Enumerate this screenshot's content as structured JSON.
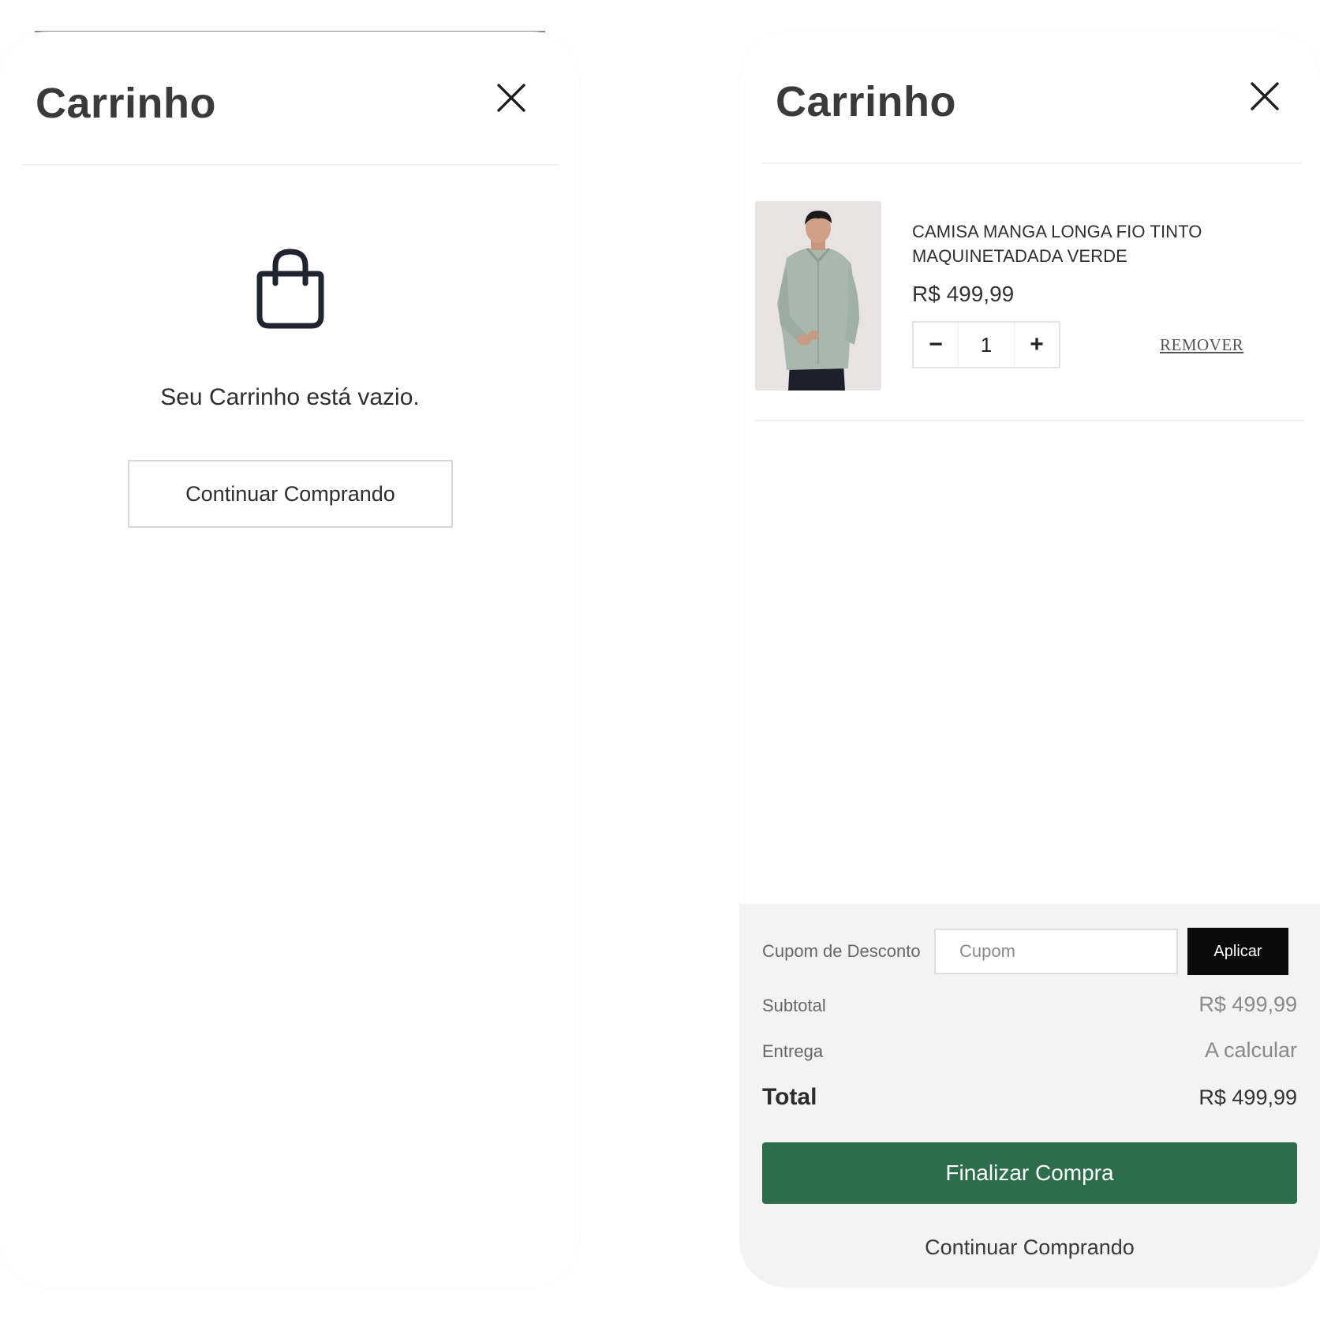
{
  "empty_cart": {
    "title": "Carrinho",
    "close_icon": "close-icon",
    "bag_icon": "shopping-bag-icon",
    "message": "Seu Carrinho está vazio.",
    "continue_label": "Continuar Comprando"
  },
  "filled_cart": {
    "title": "Carrinho",
    "close_icon": "close-icon",
    "item": {
      "name": "CAMISA MANGA LONGA FIO TINTO MAQUINETADADA VERDE",
      "price": "R$ 499,99",
      "quantity": "1",
      "decrease_label": "−",
      "increase_label": "+",
      "remove_label": "REMOVER"
    },
    "summary": {
      "coupon_label": "Cupom de Desconto",
      "coupon_placeholder": "Cupom",
      "coupon_value": "",
      "apply_label": "Aplicar",
      "subtotal_label": "Subtotal",
      "subtotal_value": "R$ 499,99",
      "delivery_label": "Entrega",
      "delivery_value": "A calcular",
      "total_label": "Total",
      "total_value": "R$ 499,99",
      "checkout_label": "Finalizar Compra",
      "continue_label": "Continuar Comprando"
    }
  },
  "colors": {
    "checkout_green": "#2e6d4c",
    "apply_black": "#0a0a0a",
    "summary_bg": "#f3f3f3"
  }
}
